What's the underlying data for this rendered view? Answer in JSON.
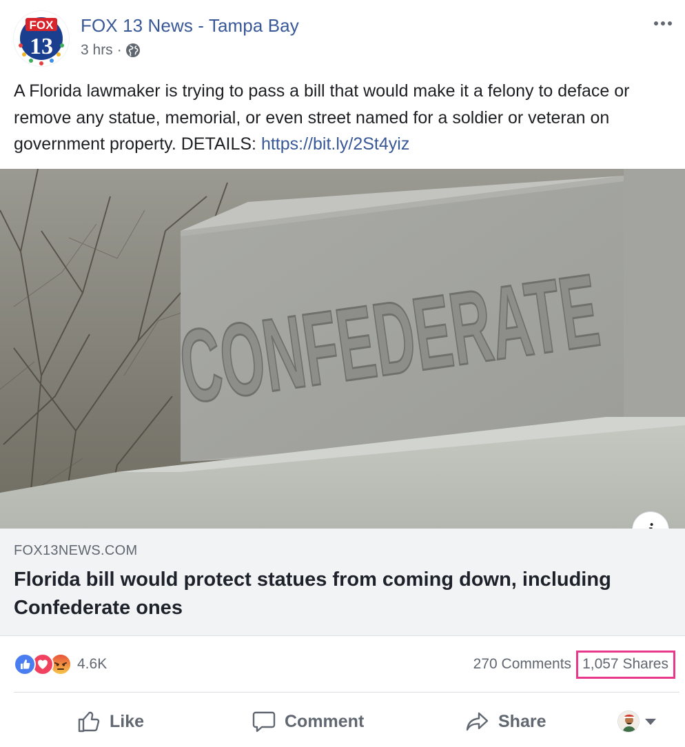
{
  "post": {
    "page_name": "FOX 13 News - Tampa Bay",
    "time": "3 hrs",
    "privacy_icon": "globe-icon",
    "text": "A Florida lawmaker is trying to pass a bill that would make it a felony to deface or remove any statue, memorial, or even street named for a soldier or veteran on government property. DETAILS: ",
    "link_text": "https://bit.ly/2St4yiz",
    "avatar": {
      "logo_top": "FOX",
      "logo_number": "13"
    }
  },
  "link_card": {
    "image_text": "CONFEDERATE",
    "info_label": "i",
    "domain": "FOX13NEWS.COM",
    "headline": "Florida bill would protect statues from coming down, including Confederate ones"
  },
  "engagement": {
    "reaction_icons": [
      "like-reaction-icon",
      "love-reaction-icon",
      "angry-reaction-icon"
    ],
    "reaction_count": "4.6K",
    "comments": "270 Comments",
    "shares": "1,057 Shares"
  },
  "actions": {
    "like": "Like",
    "comment": "Comment",
    "share": "Share"
  },
  "colors": {
    "link_blue": "#385898",
    "secondary_text": "#606770",
    "highlight_box": "#e8388c",
    "like_blue": "#4a7df0",
    "love_red": "#f0425e",
    "angry_orange": "#f6b23a"
  }
}
